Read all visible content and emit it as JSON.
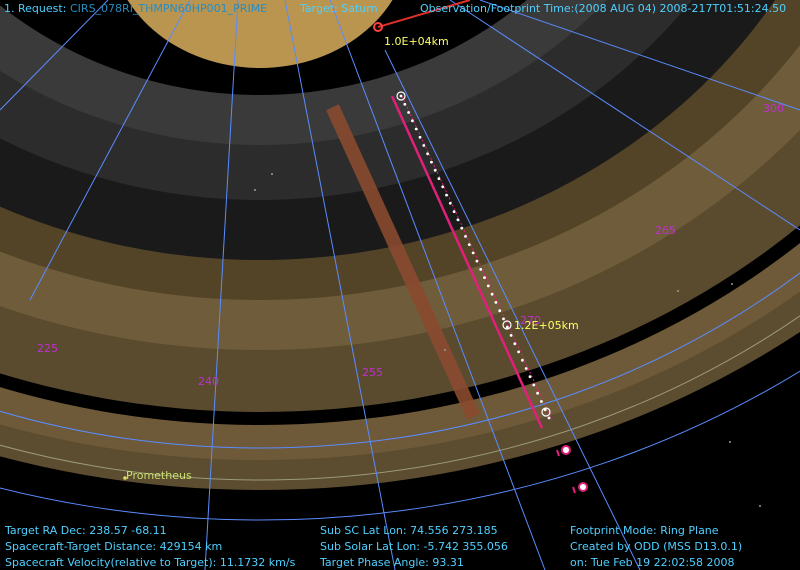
{
  "header": {
    "request_prefix": "1. Request:",
    "request_id": "CIRS_078RI_THMPN60HP001_PRIME",
    "target": "Target: Saturn",
    "obs_time": "Observation/Footprint Time:(2008 AUG 04) 2008-217T01:51:24.50"
  },
  "markers": {
    "top_scale": "1.0E+04km",
    "mid_scale": "1.2E+05km",
    "moon_name": "Prometheus"
  },
  "longitude_labels": [
    "225",
    "240",
    "255",
    "270",
    "265",
    "300"
  ],
  "footer": {
    "left": [
      "Target RA Dec: 238.57   -68.11",
      "Spacecraft-Target Distance:  429154 km",
      "Spacecraft Velocity(relative to Target): 11.1732 km/s"
    ],
    "middle": [
      "Sub SC Lat Lon: 74.556  273.185",
      "Sub Solar Lat Lon: -5.742  355.056",
      "Target Phase Angle: 93.31"
    ],
    "right": [
      "Footprint Mode: Ring Plane",
      "Created by ODD (MSS D13.0.1)",
      "on: Tue Feb 19 22:02:58 2008"
    ]
  },
  "colors": {
    "hud_text": "#4fd0ff",
    "longitude_label": "#c030d0",
    "marker_label": "#ffff66",
    "footprint": "#e0207a",
    "planet": "#d9b870",
    "grid": "#5a8cff"
  }
}
